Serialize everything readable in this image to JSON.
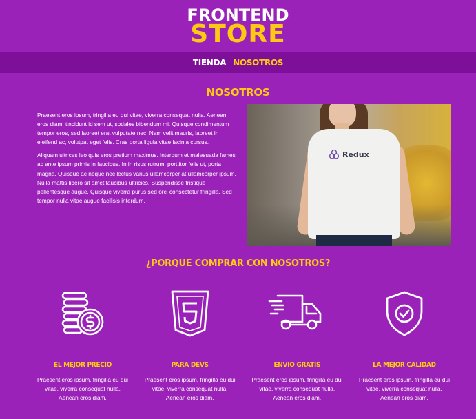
{
  "header": {
    "logo_top": "FRONTEND",
    "logo_bottom": "STORE"
  },
  "nav": {
    "items": [
      {
        "label": "TIENDA"
      },
      {
        "label": "NOSOTROS"
      }
    ]
  },
  "about": {
    "title": "NOSOTROS",
    "paragraphs": [
      "Praesent eros ipsum, fringilla eu dui vitae, viverra consequat nulla. Aenean eros diam, tincidunt id sem ut, sodales bibendum mi. Quisque condimentum tempor eros, sed laoreet erat vulputate nec. Nam velit mauris, laoreet in eleifend ac, volutpat eget felis. Cras porta ligula vitae lacinia cursus.",
      "Aliquam ultrices leo quis eros pretium maximus. Interdum et malesuada fames ac ante ipsum primis in faucibus. In in risus rutrum, porttitor felis ut, porta magna. Quisque ac neque nec lectus varius ullamcorper at ullamcorper ipsum. Nulla mattis libero sit amet faucibus ultricies. Suspendisse tristique pellentesque augue. Quisque viverra purus sed orci consectetur fringilla. Sed tempor nulla vitae augue facilisis interdum."
    ],
    "image_brand": "Redux"
  },
  "why": {
    "title": "¿PORQUE COMPRAR CON NOSOTROS?",
    "features": [
      {
        "title": "EL MEJOR PRECIO",
        "text": "Praesent eros ipsum, fringilla eu dui vitae, viverra consequat nulla. Aenean eros diam.",
        "icon": "coins-icon"
      },
      {
        "title": "PARA DEVS",
        "text": "Praesent eros ipsum, fringilla eu dui vitae, viverra consequat nulla. Aenean eros diam.",
        "icon": "html5-icon"
      },
      {
        "title": "ENVIO GRATIS",
        "text": "Praesent eros ipsum, fringilla eu dui vitae, viverra consequat nulla. Aenean eros diam.",
        "icon": "truck-icon"
      },
      {
        "title": "LA MEJOR CALIDAD",
        "text": "Praesent eros ipsum, fringilla eu dui vitae, viverra consequat nulla. Aenean eros diam.",
        "icon": "shield-check-icon"
      }
    ]
  },
  "colors": {
    "background": "#9b22b8",
    "nav_background": "#7e0f99",
    "accent": "#fdc913",
    "text": "#ffffff"
  }
}
